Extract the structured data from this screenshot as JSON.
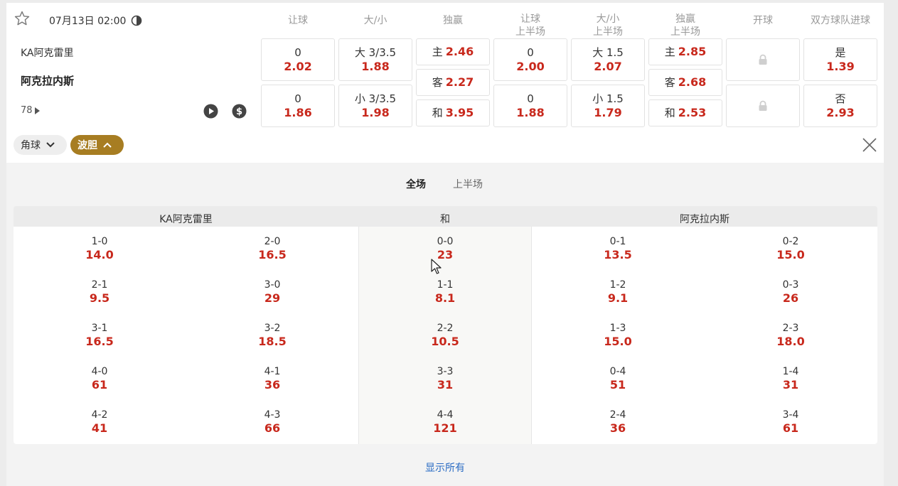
{
  "match": {
    "datetime": "07月13日 02:00",
    "home_team": "KA阿克雷里",
    "away_team": "阿克拉内斯",
    "more_count": "78"
  },
  "columns": [
    {
      "line1": "让球",
      "line2": ""
    },
    {
      "line1": "大/小",
      "line2": ""
    },
    {
      "line1": "独赢",
      "line2": ""
    },
    {
      "line1": "让球",
      "line2": "上半场"
    },
    {
      "line1": "大/小",
      "line2": "上半场"
    },
    {
      "line1": "独赢",
      "line2": "上半场"
    },
    {
      "line1": "开球",
      "line2": ""
    },
    {
      "line1": "双方球队进球",
      "line2": ""
    }
  ],
  "odds": {
    "hcap_ft": [
      {
        "label": "0",
        "odd": "2.02"
      },
      {
        "label": "0",
        "odd": "1.86"
      }
    ],
    "ou_ft": [
      {
        "label": "大 3/3.5",
        "odd": "1.88"
      },
      {
        "label": "小 3/3.5",
        "odd": "1.98"
      }
    ],
    "mw_ft": [
      {
        "label": "主",
        "odd": "2.46"
      },
      {
        "label": "客",
        "odd": "2.27"
      },
      {
        "label": "和",
        "odd": "3.95"
      }
    ],
    "hcap_ht": [
      {
        "label": "0",
        "odd": "2.00"
      },
      {
        "label": "0",
        "odd": "1.88"
      }
    ],
    "ou_ht": [
      {
        "label": "大 1.5",
        "odd": "2.07"
      },
      {
        "label": "小 1.5",
        "odd": "1.79"
      }
    ],
    "mw_ht": [
      {
        "label": "主",
        "odd": "2.85"
      },
      {
        "label": "客",
        "odd": "2.68"
      },
      {
        "label": "和",
        "odd": "2.53"
      }
    ],
    "btts": [
      {
        "label": "是",
        "odd": "1.39"
      },
      {
        "label": "否",
        "odd": "2.93"
      }
    ]
  },
  "filters": {
    "corner": "角球",
    "correct_score": "波胆"
  },
  "tabs": {
    "full": "全场",
    "half": "上半场"
  },
  "score_grid": {
    "headers": {
      "home": "KA阿克雷里",
      "draw": "和",
      "away": "阿克拉内斯"
    },
    "home_a": [
      {
        "s": "1-0",
        "o": "14.0"
      },
      {
        "s": "2-1",
        "o": "9.5"
      },
      {
        "s": "3-1",
        "o": "16.5"
      },
      {
        "s": "4-0",
        "o": "61"
      },
      {
        "s": "4-2",
        "o": "41"
      }
    ],
    "home_b": [
      {
        "s": "2-0",
        "o": "16.5"
      },
      {
        "s": "3-0",
        "o": "29"
      },
      {
        "s": "3-2",
        "o": "18.5"
      },
      {
        "s": "4-1",
        "o": "36"
      },
      {
        "s": "4-3",
        "o": "66"
      }
    ],
    "draw": [
      {
        "s": "0-0",
        "o": "23"
      },
      {
        "s": "1-1",
        "o": "8.1"
      },
      {
        "s": "2-2",
        "o": "10.5"
      },
      {
        "s": "3-3",
        "o": "31"
      },
      {
        "s": "4-4",
        "o": "121"
      }
    ],
    "away_a": [
      {
        "s": "0-1",
        "o": "13.5"
      },
      {
        "s": "1-2",
        "o": "9.1"
      },
      {
        "s": "1-3",
        "o": "15.0"
      },
      {
        "s": "0-4",
        "o": "51"
      },
      {
        "s": "2-4",
        "o": "36"
      }
    ],
    "away_b": [
      {
        "s": "0-2",
        "o": "15.0"
      },
      {
        "s": "0-3",
        "o": "26"
      },
      {
        "s": "2-3",
        "o": "18.0"
      },
      {
        "s": "1-4",
        "o": "31"
      },
      {
        "s": "3-4",
        "o": "61"
      }
    ]
  },
  "show_all": "显示所有",
  "colors": {
    "odd_red": "#c8281c",
    "gold": "#a77d22",
    "link_blue": "#2b6cc4"
  }
}
